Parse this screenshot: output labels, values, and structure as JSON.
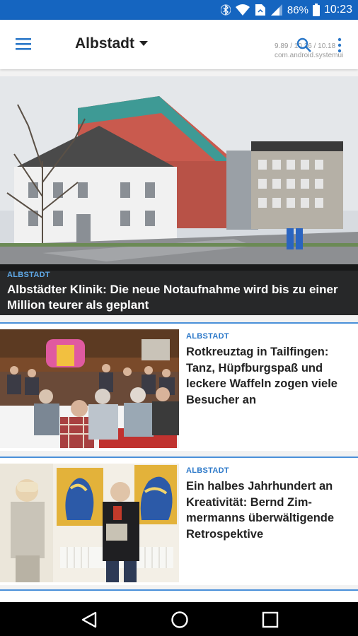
{
  "status_bar": {
    "battery": "86%",
    "time": "10:23",
    "icons": [
      "bluetooth-icon",
      "wifi-icon",
      "file-icon",
      "signal-icon",
      "battery-icon"
    ]
  },
  "app_bar": {
    "title": "Albstadt",
    "icons": [
      "menu-icon",
      "dropdown-arrow-icon",
      "search-icon",
      "more-options-icon"
    ],
    "debug_overlay": {
      "line1": "9.89 / 10.36 / 10.18",
      "line2": "com.android.systemui"
    }
  },
  "hero_article": {
    "category": "ALBSTADT",
    "title": "Albstädter Klinik: Die neue Notaufnahme wird bis zu einer Million teurer als geplant"
  },
  "articles": [
    {
      "category": "ALBSTADT",
      "title": "Rotkreuztag in Tailfingen: Tanz, Hüpfburgspaß und leckere Waffeln zogen viele Besucher an"
    },
    {
      "category": "ALBSTADT",
      "title": "Ein halbes Jahrhundert an Kreativität: Bernd Zim-mermanns überwältigende Retrospektive"
    }
  ],
  "nav_bar": {
    "icons": [
      "back-icon",
      "home-icon",
      "recents-icon"
    ]
  },
  "colors": {
    "status_bar": "#1565c0",
    "accent": "#2a77c8",
    "card_divider": "#4a90d9",
    "hero_caption_bg": "#000000"
  }
}
